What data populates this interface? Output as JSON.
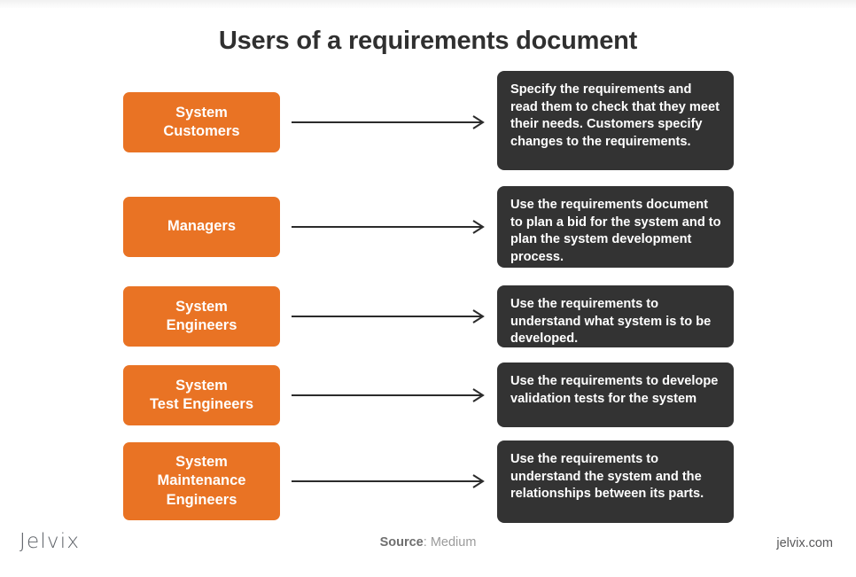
{
  "title": "Users of a requirements document",
  "colors": {
    "actor_box": "#e97324",
    "desc_box": "#333333",
    "background": "#ffffff",
    "title_text": "#303030",
    "arrow": "#2b2b2b"
  },
  "rows": [
    {
      "actor": "System\nCustomers",
      "actor_lines": [
        "System",
        "Customers"
      ],
      "description": "Specify the requirements and read them to check that they meet their needs. Customers specify changes to the requirements.",
      "arrow": "arrow-right"
    },
    {
      "actor": "Managers",
      "actor_lines": [
        "Managers"
      ],
      "description": "Use the requirements document to plan a bid for the system and to plan the system development process.",
      "arrow": "arrow-right"
    },
    {
      "actor": "System\nEngineers",
      "actor_lines": [
        "System",
        "Engineers"
      ],
      "description": "Use the requirements to understand what system is to be developed.",
      "arrow": "arrow-right"
    },
    {
      "actor": "System\nTest Engineers",
      "actor_lines": [
        "System",
        "Test Engineers"
      ],
      "description": "Use the requirements to develope validation tests for the system",
      "arrow": "arrow-right"
    },
    {
      "actor": "System\nMaintenance\nEngineers",
      "actor_lines": [
        "System",
        "Maintenance",
        "Engineers"
      ],
      "description": "Use the requirements to understand the system and the relationships between its parts.",
      "arrow": "arrow-right"
    }
  ],
  "footer": {
    "logo": "Jelvix",
    "source_label": "Source",
    "source_separator": ": ",
    "source_value": "Medium",
    "url": "jelvix.com"
  }
}
